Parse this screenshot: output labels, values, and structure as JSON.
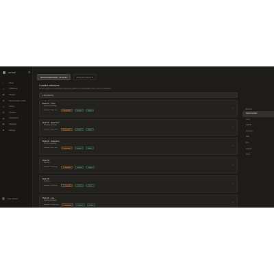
{
  "sidebar": {
    "title": "Arcvault",
    "toggle_icon": "collapse-icon",
    "items": [
      {
        "icon": "home-icon",
        "label": "Home"
      },
      {
        "icon": "folder-icon",
        "label": "Collections"
      },
      {
        "icon": "grid-icon",
        "label": "Registry"
      },
      {
        "icon": "book-icon",
        "label": "Documentation Index"
      },
      {
        "icon": "clock-icon",
        "label": "Activity"
      },
      {
        "icon": "chart-icon",
        "label": "Analytics"
      },
      {
        "icon": "users-icon",
        "label": "Contributors"
      },
      {
        "icon": "box-icon",
        "label": "Releases"
      },
      {
        "icon": "gear-icon",
        "label": "Settings"
      }
    ],
    "footer": "User account"
  },
  "tabs": [
    {
      "label": "Recommended builds · 24 results",
      "active": true
    },
    {
      "label": "Previously viewed · 8",
      "active": false
    }
  ],
  "main": {
    "title": "Curated selections",
    "subtitle": "Browse suggested configurations grouped by platform and compatibility status, sorted by relevance.",
    "filter": "All platforms",
    "cards": [
      {
        "name": "Build 01 · Core",
        "sub": "Runtime package",
        "meta": "Updated 2 days ago",
        "tags": [
          "Compatible",
          "Verified",
          "Stable"
        ]
      },
      {
        "name": "Build 02 · Extended",
        "sub": "Runtime package",
        "meta": "Updated 3 days ago",
        "tags": [
          "Compatible",
          "Verified",
          "Stable"
        ]
      },
      {
        "name": "Build 03 · Extended",
        "sub": "Runtime package",
        "meta": "Updated 5 days ago",
        "tags": [
          "Compatible",
          "Verified",
          "Stable"
        ]
      },
      {
        "name": "Build 04",
        "sub": "Runtime",
        "meta": "Updated 1 week ago",
        "tags": [
          "Compatible",
          "Verified",
          "Stable"
        ]
      },
      {
        "name": "Build 05",
        "sub": "Runtime",
        "meta": "Updated 1 week ago",
        "tags": [
          "Compatible",
          "Verified",
          "Stable"
        ]
      },
      {
        "name": "Build 06 · Lite",
        "sub": "Runtime package",
        "meta": "Updated 2 weeks ago",
        "tags": [
          "Compatible",
          "Verified",
          "Stable"
        ]
      }
    ]
  },
  "right_panel": {
    "heading": "Platforms",
    "items": [
      "Recommended",
      "Linux",
      "macOS",
      "Windows",
      "Web",
      "iOS",
      "Android",
      "Other"
    ]
  }
}
